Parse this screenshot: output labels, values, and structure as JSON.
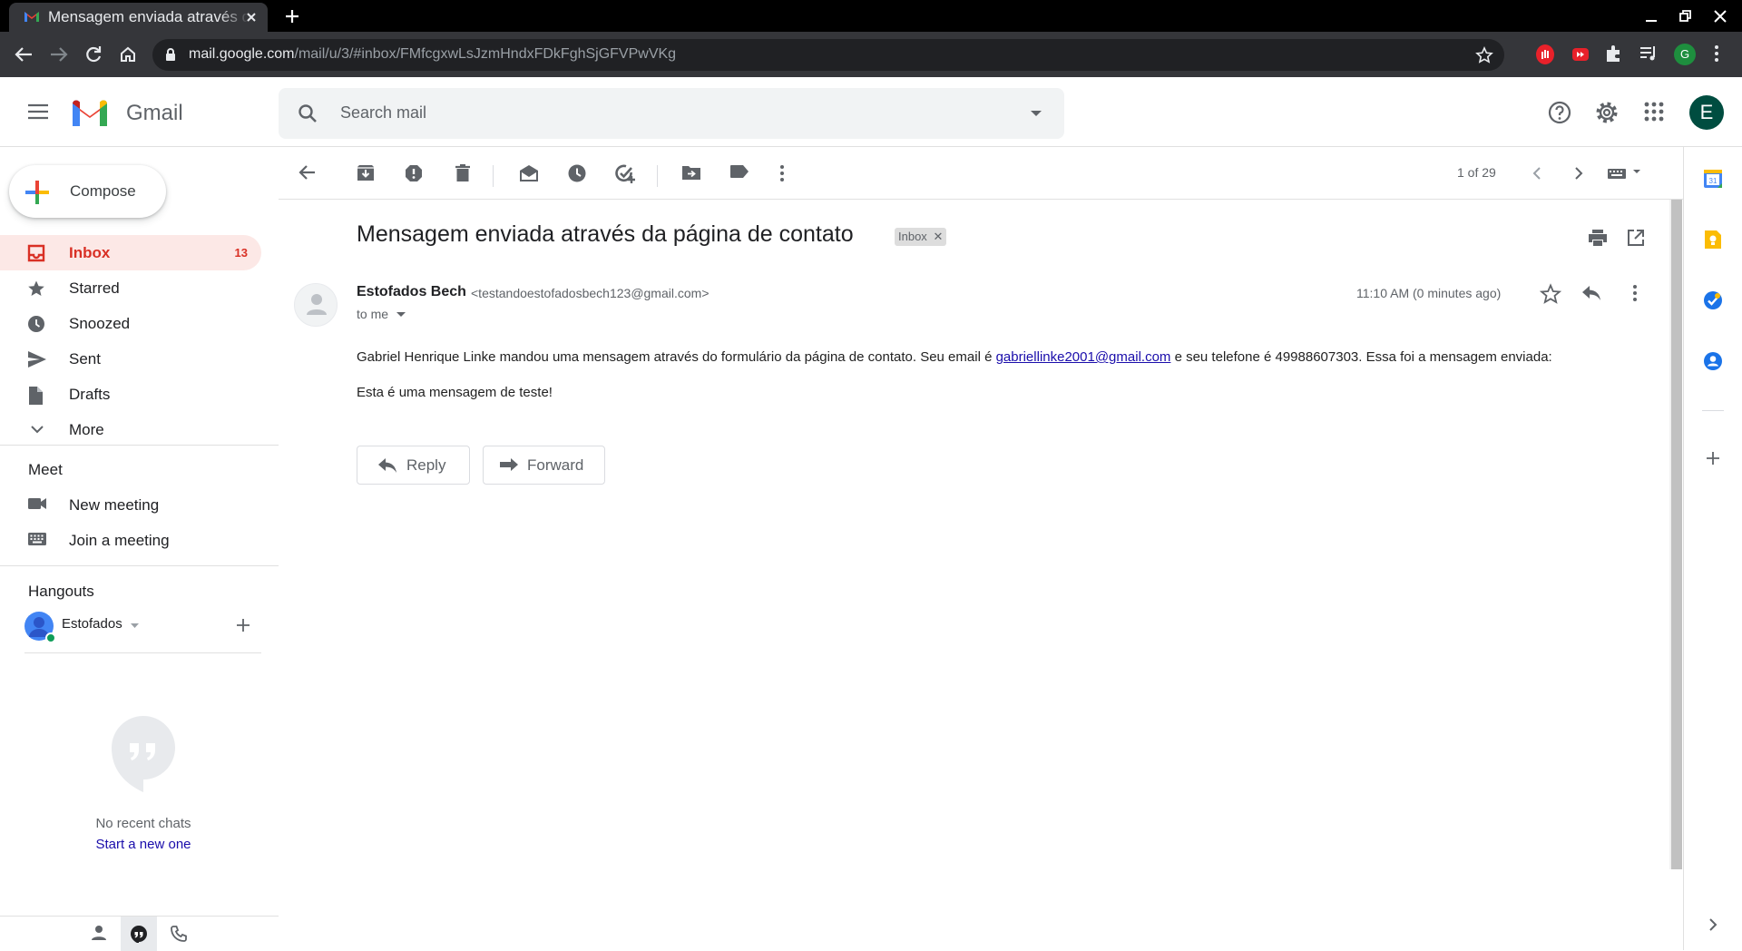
{
  "browser": {
    "tab_title": "Mensagem enviada através da página de contato",
    "url_host": "mail.google.com",
    "url_path": "/mail/u/3/#inbox/FMfcgxwLsJzmHndxFDkFghSjGFVPwVKg",
    "profile_initial": "G"
  },
  "header": {
    "app_name": "Gmail",
    "search_placeholder": "Search mail",
    "account_initial": "E"
  },
  "sidebar": {
    "compose_label": "Compose",
    "items": [
      {
        "label": "Inbox",
        "count": "13",
        "icon": "inbox-icon",
        "active": true
      },
      {
        "label": "Starred",
        "count": "",
        "icon": "star-icon"
      },
      {
        "label": "Snoozed",
        "count": "",
        "icon": "clock-icon"
      },
      {
        "label": "Sent",
        "count": "",
        "icon": "send-icon"
      },
      {
        "label": "Drafts",
        "count": "",
        "icon": "draft-icon"
      },
      {
        "label": "More",
        "count": "",
        "icon": "chevron-down-icon"
      }
    ],
    "meet": {
      "title": "Meet",
      "new_meeting": "New meeting",
      "join_meeting": "Join a meeting"
    },
    "hangouts": {
      "title": "Hangouts",
      "user": "Estofados",
      "no_chats": "No recent chats",
      "start_new": "Start a new one"
    }
  },
  "toolbar": {
    "pager": "1 of 29"
  },
  "message": {
    "subject": "Mensagem enviada através da página de contato",
    "label_chip": "Inbox",
    "sender_name": "Estofados Bech",
    "sender_email": "<testandoestofadosbech123@gmail.com>",
    "to": "to me",
    "time": "11:10 AM (0 minutes ago)",
    "body_part1": "Gabriel Henrique Linke mandou uma mensagem através do formulário da página de contato. Seu email é ",
    "body_link": "gabriellinke2001@gmail.com",
    "body_part2": " e seu telefone é 49988607303. Essa foi a mensagem enviada:",
    "body_line2": "Esta é uma mensagem de teste!",
    "reply_label": "Reply",
    "forward_label": "Forward"
  },
  "colors": {
    "accent_red": "#d93025",
    "active_bg": "#fce8e6",
    "link": "#1a0dab"
  }
}
